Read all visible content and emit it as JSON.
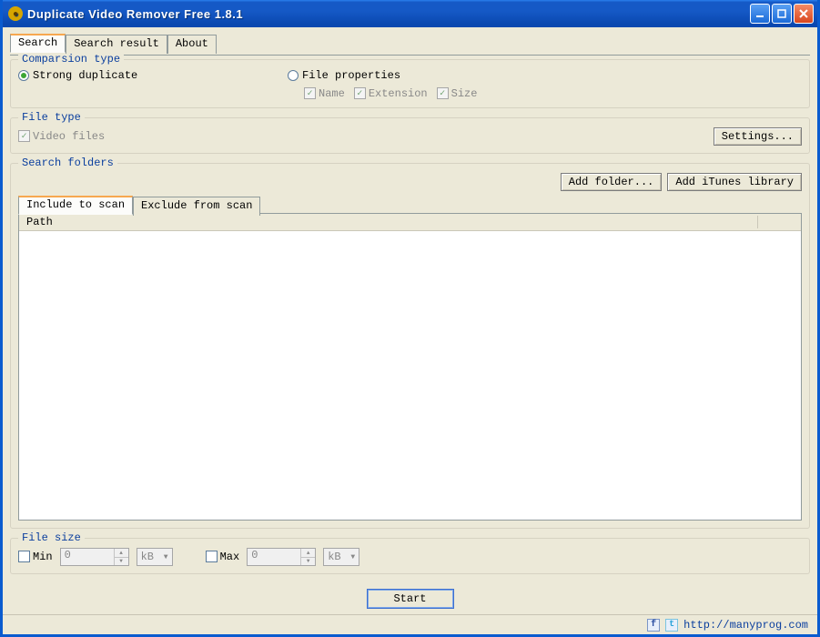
{
  "window": {
    "title": "Duplicate Video Remover Free 1.8.1"
  },
  "tabs": {
    "search": "Search",
    "search_result": "Search result",
    "about": "About"
  },
  "comparison": {
    "legend": "Comparsion type",
    "strong_label": "Strong duplicate",
    "fileprops_label": "File properties",
    "sub_name": "Name",
    "sub_extension": "Extension",
    "sub_size": "Size"
  },
  "file_type": {
    "legend": "File type",
    "video_files": "Video files",
    "settings_btn": "Settings..."
  },
  "search_folders": {
    "legend": "Search folders",
    "add_folder_btn": "Add folder...",
    "add_itunes_btn": "Add iTunes library",
    "tab_include": "Include to scan",
    "tab_exclude": "Exclude from scan",
    "col_path": "Path"
  },
  "file_size": {
    "legend": "File size",
    "min_label": "Min",
    "max_label": "Max",
    "min_value": "0",
    "max_value": "0",
    "unit": "kB"
  },
  "start_btn": "Start",
  "status": {
    "url": "http://manyprog.com"
  }
}
